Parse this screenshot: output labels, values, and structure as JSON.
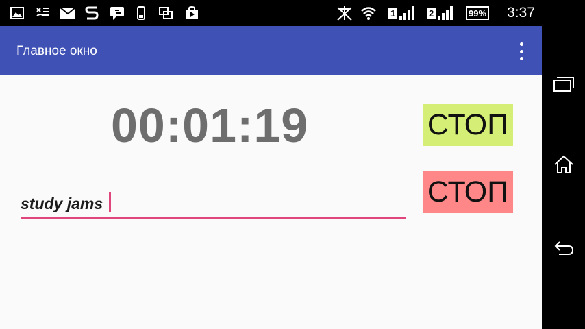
{
  "status_bar": {
    "time": "3:37",
    "battery": "99%",
    "sim1": "1",
    "sim2": "2",
    "icons": [
      "gallery-icon",
      "missed-call-icon",
      "email-icon",
      "app-s-icon",
      "chat-icon",
      "phone-icon",
      "screen-icon",
      "store-icon",
      "no-signal-icon",
      "wifi-icon",
      "signal-icon",
      "battery-icon"
    ]
  },
  "app_bar": {
    "title": "Главное окно",
    "overflow_icon": "more-vert-icon"
  },
  "timer": {
    "value": "00:01:19"
  },
  "buttons": {
    "stop_green_label": "СТОП",
    "stop_red_label": "СТОП",
    "green_color": "#d4ee76",
    "red_color": "#ff8787"
  },
  "task": {
    "value": "study jams"
  },
  "navigation": {
    "icons": [
      "recent-apps-icon",
      "home-icon",
      "back-icon"
    ]
  },
  "colors": {
    "primary": "#3f51b5",
    "accent": "#e0457b"
  }
}
